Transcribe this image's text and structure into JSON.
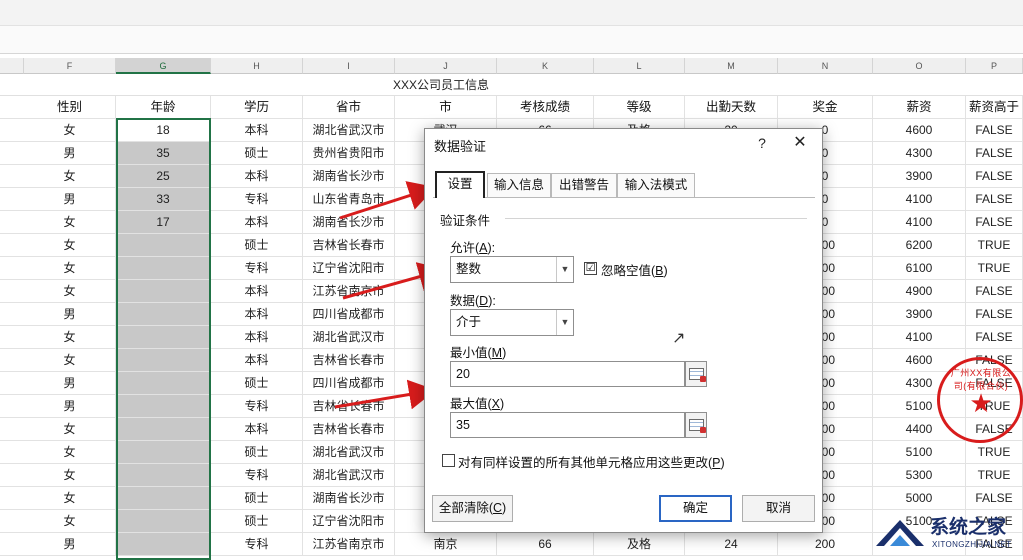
{
  "column_letters": [
    "F",
    "G",
    "H",
    "I",
    "J",
    "K",
    "L",
    "M",
    "N",
    "O",
    "P"
  ],
  "sheet_title": "XXX公司员工信息",
  "headers": [
    "性别",
    "年龄",
    "学历",
    "省市",
    "市",
    "考核成绩",
    "等级",
    "出勤天数",
    "奖金",
    "薪资",
    "薪资高于"
  ],
  "rows": [
    {
      "gender": "女",
      "age": "18",
      "edu": "本科",
      "prov": "湖北省武汉市",
      "city": "武汉",
      "score": "66",
      "level": "及格",
      "days": "20",
      "bonus": "0",
      "salary": "4600",
      "above": "FALSE"
    },
    {
      "gender": "男",
      "age": "35",
      "edu": "硕士",
      "prov": "贵州省贵阳市",
      "city": "",
      "score": "",
      "level": "",
      "days": "",
      "bonus": "0",
      "salary": "4300",
      "above": "FALSE"
    },
    {
      "gender": "女",
      "age": "25",
      "edu": "本科",
      "prov": "湖南省长沙市",
      "city": "",
      "score": "",
      "level": "",
      "days": "",
      "bonus": "0",
      "salary": "3900",
      "above": "FALSE"
    },
    {
      "gender": "男",
      "age": "33",
      "edu": "专科",
      "prov": "山东省青岛市",
      "city": "",
      "score": "",
      "level": "",
      "days": "",
      "bonus": "0",
      "salary": "4100",
      "above": "FALSE"
    },
    {
      "gender": "女",
      "age": "17",
      "edu": "本科",
      "prov": "湖南省长沙市",
      "city": "",
      "score": "",
      "level": "",
      "days": "",
      "bonus": "0",
      "salary": "4100",
      "above": "FALSE"
    },
    {
      "gender": "女",
      "age": "",
      "edu": "硕士",
      "prov": "吉林省长春市",
      "city": "",
      "score": "",
      "level": "",
      "days": "",
      "bonus": "200",
      "salary": "6200",
      "above": "TRUE"
    },
    {
      "gender": "女",
      "age": "",
      "edu": "专科",
      "prov": "辽宁省沈阳市",
      "city": "",
      "score": "",
      "level": "",
      "days": "",
      "bonus": "200",
      "salary": "6100",
      "above": "TRUE"
    },
    {
      "gender": "女",
      "age": "",
      "edu": "本科",
      "prov": "江苏省南京市",
      "city": "",
      "score": "",
      "level": "",
      "days": "",
      "bonus": "200",
      "salary": "4900",
      "above": "FALSE"
    },
    {
      "gender": "男",
      "age": "",
      "edu": "本科",
      "prov": "四川省成都市",
      "city": "",
      "score": "",
      "level": "",
      "days": "",
      "bonus": "200",
      "salary": "3900",
      "above": "FALSE"
    },
    {
      "gender": "女",
      "age": "",
      "edu": "本科",
      "prov": "湖北省武汉市",
      "city": "",
      "score": "",
      "level": "",
      "days": "",
      "bonus": "200",
      "salary": "4100",
      "above": "FALSE"
    },
    {
      "gender": "女",
      "age": "",
      "edu": "本科",
      "prov": "吉林省长春市",
      "city": "",
      "score": "",
      "level": "",
      "days": "",
      "bonus": "200",
      "salary": "4600",
      "above": "FALSE"
    },
    {
      "gender": "男",
      "age": "",
      "edu": "硕士",
      "prov": "四川省成都市",
      "city": "",
      "score": "",
      "level": "",
      "days": "",
      "bonus": "200",
      "salary": "4300",
      "above": "FALSE"
    },
    {
      "gender": "男",
      "age": "",
      "edu": "专科",
      "prov": "吉林省长春市",
      "city": "",
      "score": "",
      "level": "",
      "days": "",
      "bonus": "200",
      "salary": "5100",
      "above": "TRUE"
    },
    {
      "gender": "女",
      "age": "",
      "edu": "本科",
      "prov": "吉林省长春市",
      "city": "",
      "score": "",
      "level": "",
      "days": "",
      "bonus": "200",
      "salary": "4400",
      "above": "FALSE"
    },
    {
      "gender": "女",
      "age": "",
      "edu": "硕士",
      "prov": "湖北省武汉市",
      "city": "",
      "score": "",
      "level": "",
      "days": "",
      "bonus": "200",
      "salary": "5100",
      "above": "TRUE"
    },
    {
      "gender": "女",
      "age": "",
      "edu": "专科",
      "prov": "湖北省武汉市",
      "city": "",
      "score": "",
      "level": "",
      "days": "",
      "bonus": "200",
      "salary": "5300",
      "above": "TRUE"
    },
    {
      "gender": "女",
      "age": "",
      "edu": "硕士",
      "prov": "湖南省长沙市",
      "city": "",
      "score": "",
      "level": "",
      "days": "",
      "bonus": "200",
      "salary": "5000",
      "above": "FALSE"
    },
    {
      "gender": "女",
      "age": "",
      "edu": "硕士",
      "prov": "辽宁省沈阳市",
      "city": "",
      "score": "",
      "level": "",
      "days": "",
      "bonus": "200",
      "salary": "5100",
      "above": "FALSE"
    },
    {
      "gender": "男",
      "age": "",
      "edu": "专科",
      "prov": "江苏省南京市",
      "city": "南京",
      "score": "66",
      "level": "及格",
      "days": "24",
      "bonus": "200",
      "salary": "",
      "above": "FALSE"
    }
  ],
  "dialog": {
    "title": "数据验证",
    "help": "?",
    "close": "✕",
    "tabs": [
      "设置",
      "输入信息",
      "出错警告",
      "输入法模式"
    ],
    "group_title": "验证条件",
    "allow_label": "允许(",
    "allow_key": "A",
    "allow_close": "):",
    "allow_value": "整数",
    "ignore_blank_label": "忽略空值(",
    "ignore_blank_key": "B",
    "ignore_blank_close": ")",
    "ignore_blank_checked": "☑",
    "data_label": "数据(",
    "data_key": "D",
    "data_close": "):",
    "data_value": "介于",
    "min_label": "最小值(",
    "min_key": "M",
    "min_close": ")",
    "min_value": "20",
    "max_label": "最大值(",
    "max_key": "X",
    "max_close": ")",
    "max_value": "35",
    "apply_all_label": "对有同样设置的所有其他单元格应用这些更改(",
    "apply_all_key": "P",
    "apply_all_close": ")",
    "clear_all": "全部清除(",
    "clear_all_key": "C",
    "clear_all_close": ")",
    "ok": "确定",
    "cancel": "取消"
  },
  "stamp": {
    "text": "广州XX有限公司(有限合伙)",
    "star": "★"
  },
  "watermark": {
    "brand": "系统之家",
    "url": "XITONGZHIJIA.NET"
  },
  "colors": {
    "accent_green": "#217346",
    "arrow_red": "#d81c1c",
    "primary_button": "#2a66c4"
  }
}
